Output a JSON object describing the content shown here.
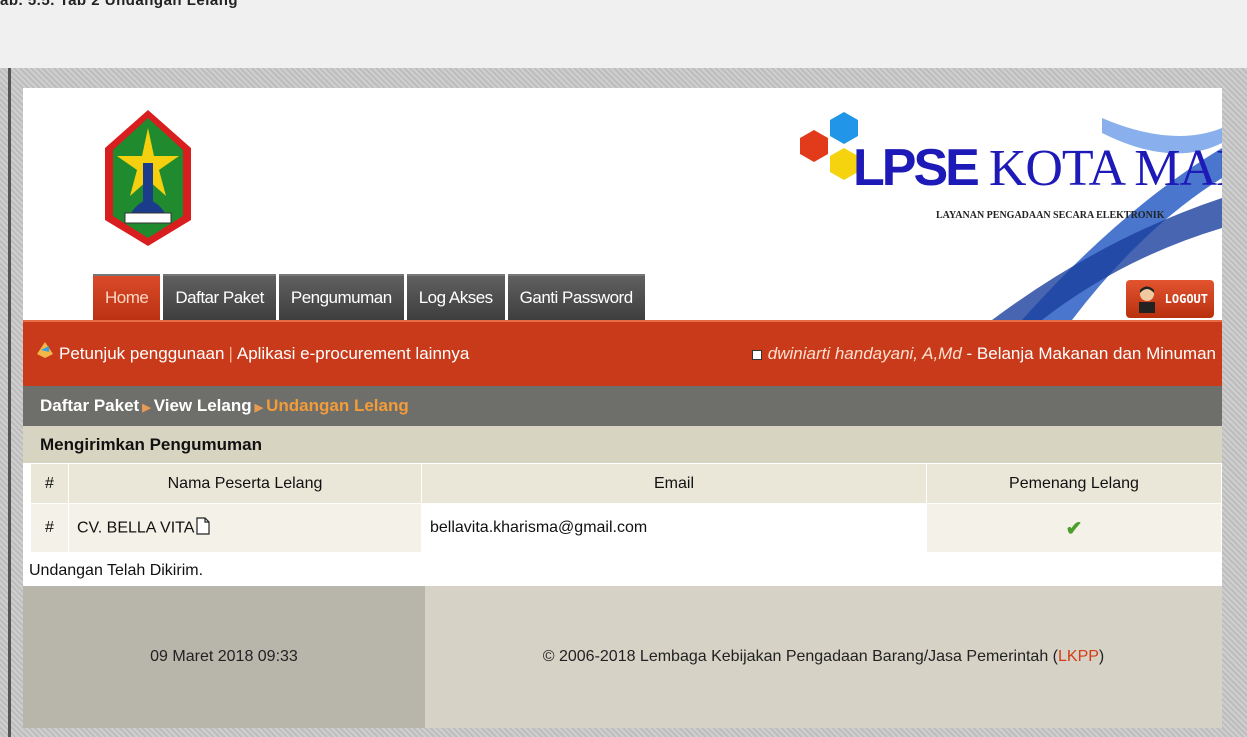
{
  "caption": "ab. 5.5. Tab 2 Undangan Lelang",
  "header": {
    "brand_strong": "LPSE",
    "brand_rest": "KOTA MALANG",
    "brand_sub": "LAYANAN PENGADAAN SECARA ELEKTRONIK",
    "logout_label": "LOGOUT"
  },
  "tabs": [
    {
      "label": "Home",
      "active": true
    },
    {
      "label": "Daftar Paket",
      "active": false
    },
    {
      "label": "Pengumuman",
      "active": false
    },
    {
      "label": "Log Akses",
      "active": false
    },
    {
      "label": "Ganti Password",
      "active": false
    }
  ],
  "redbar": {
    "help_link": "Petunjuk penggunaan",
    "other_link": "Aplikasi e-procurement lainnya",
    "user_name": "dwiniarti handayani, A,Md",
    "user_role": " - Belanja Makanan dan Minuman"
  },
  "breadcrumb": {
    "item1": "Daftar Paket",
    "item2": "View Lelang",
    "item3": "Undangan Lelang"
  },
  "section_title": "Mengirimkan Pengumuman",
  "table": {
    "headers": [
      "#",
      "Nama Peserta Lelang",
      "Email",
      "Pemenang Lelang"
    ],
    "rows": [
      {
        "num": "#",
        "name": "CV. BELLA VITA",
        "email": "bellavita.kharisma@gmail.com",
        "winner": "✔"
      }
    ]
  },
  "status_text": "Undangan Telah Dikirim.",
  "footer": {
    "date": "09 Maret 2018 09:33",
    "copyright_pre": "© 2006-2018 Lembaga Kebijakan Pengadaan Barang/Jasa Pemerintah (",
    "copyright_link": "LKPP",
    "copyright_post": ")"
  },
  "colors": {
    "accent_red": "#c83a1a",
    "breadcrumb_bg": "#6e6e6a",
    "breadcrumb_current": "#f39c3a",
    "brand_blue": "#1d1ab8"
  }
}
